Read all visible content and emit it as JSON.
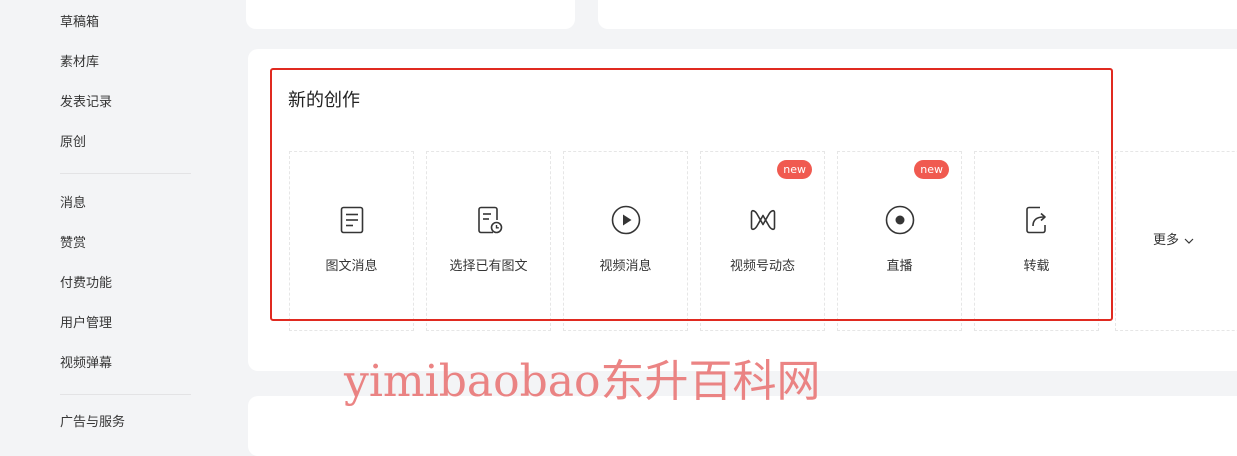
{
  "sidebar": {
    "group1": [
      "草稿箱",
      "素材库",
      "发表记录",
      "原创"
    ],
    "group2": [
      "消息",
      "赞赏",
      "付费功能",
      "用户管理",
      "视频弹幕"
    ],
    "group3": [
      "广告与服务"
    ]
  },
  "create": {
    "title": "新的创作",
    "tiles": [
      {
        "label": "图文消息",
        "icon": "document-icon",
        "badge": null
      },
      {
        "label": "选择已有图文",
        "icon": "document-clock-icon",
        "badge": null
      },
      {
        "label": "视频消息",
        "icon": "play-circle-icon",
        "badge": null
      },
      {
        "label": "视频号动态",
        "icon": "channels-icon",
        "badge": "new"
      },
      {
        "label": "直播",
        "icon": "live-dot-icon",
        "badge": "new"
      },
      {
        "label": "转载",
        "icon": "share-document-icon",
        "badge": null
      }
    ],
    "more_label": "更多"
  },
  "watermark": "yimibaobao东升百科网",
  "colors": {
    "highlight": "#e02a20",
    "badge": "#f05a50",
    "background": "#f3f4f6",
    "watermark": "#e86e6e"
  }
}
